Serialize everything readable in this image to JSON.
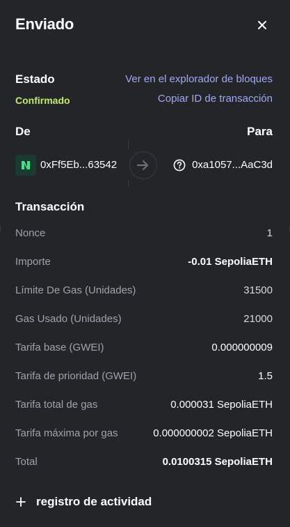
{
  "header": {
    "title": "Enviado"
  },
  "status": {
    "label": "Estado",
    "value": "Confirmado",
    "explorer_link": "Ver en el explorador de bloques",
    "copy_link": "Copiar ID de transacción"
  },
  "parties": {
    "from_label": "De",
    "to_label": "Para",
    "from_address": "0xFf5Eb...63542",
    "to_address": "0xa1057...AaC3d"
  },
  "transaction": {
    "title": "Transacción",
    "rows": [
      {
        "label": "Nonce",
        "value": "1"
      },
      {
        "label": "Importe",
        "value": "-0.01 SepoliaETH"
      },
      {
        "label": "Límite De Gas (Unidades)",
        "value": "31500"
      },
      {
        "label": "Gas Usado (Unidades)",
        "value": "21000"
      },
      {
        "label": "Tarifa base (GWEI)",
        "value": "0.000000009"
      },
      {
        "label": "Tarifa de prioridad (GWEI)",
        "value": "1.5"
      },
      {
        "label": "Tarifa total de gas",
        "value": "0.000031 SepoliaETH"
      },
      {
        "label": "Tarifa máxima por gas",
        "value": "0.000000002 SepoliaETH"
      },
      {
        "label": "Total",
        "value": "0.0100315 SepoliaETH"
      }
    ]
  },
  "activity": {
    "label": "registro de actividad"
  },
  "colors": {
    "background": "#242528",
    "accent_link": "#9fa9f6",
    "confirmed": "#c0eb6b",
    "muted_text": "#a0a3a8"
  }
}
